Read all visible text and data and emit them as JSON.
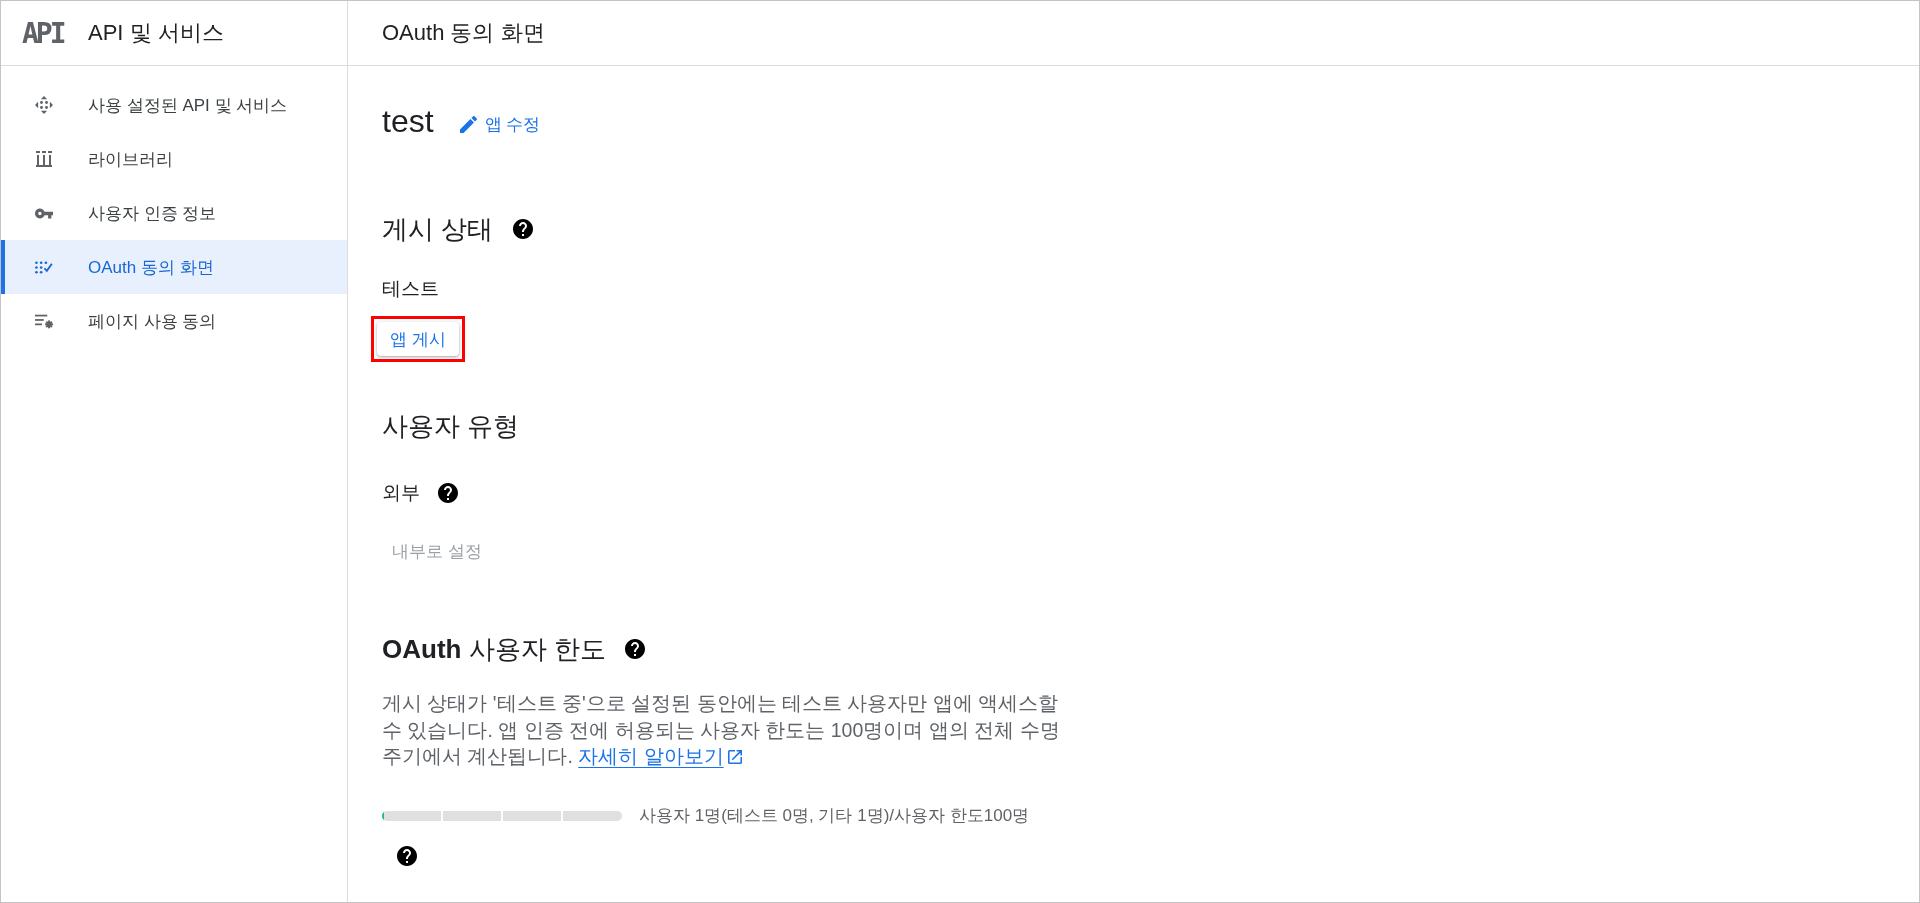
{
  "sidebar": {
    "logo": "API",
    "title": "API 및 서비스",
    "items": [
      {
        "label": "사용 설정된 API 및 서비스",
        "selected": false
      },
      {
        "label": "라이브러리",
        "selected": false
      },
      {
        "label": "사용자 인증 정보",
        "selected": false
      },
      {
        "label": "OAuth 동의 화면",
        "selected": true
      },
      {
        "label": "페이지 사용 동의",
        "selected": false
      }
    ]
  },
  "header": {
    "title": "OAuth 동의 화면"
  },
  "app": {
    "name": "test",
    "edit_link": "앱 수정"
  },
  "publishing_status": {
    "heading": "게시 상태",
    "status": "테스트",
    "publish_button": {
      "label": "앱 게시",
      "highlighted": true
    }
  },
  "user_type": {
    "heading": "사용자 유형",
    "type": "외부",
    "action": {
      "label": "내부로 설정",
      "disabled": true
    }
  },
  "user_cap": {
    "heading": "**OAuth** 사용자 한도",
    "description": "게시 상태가 '테스트 중'으로 설정된 동안에는 테스트 사용자만 앱에 액세스할 수 있습니다. 앱 인증 전에 허용되는 사용자 한도는 100명이며 앱의 전체 수명 주기에서 계산됩니다.",
    "learn_more_link": "자세히 알아보기",
    "level": 0.01,
    "reading": "사용자 1명(테스트 0명, 기타 1명)/사용자 한도100명"
  }
}
